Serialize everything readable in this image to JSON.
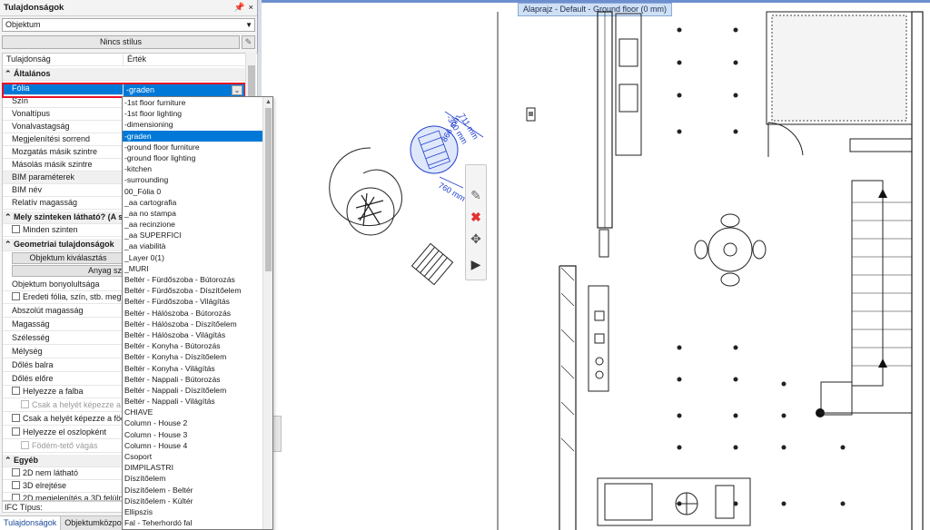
{
  "panel": {
    "title": "Tulajdonságok",
    "pin_glyph": "ᵖ",
    "close_glyph": "×",
    "object_select": "Objektum",
    "style_button": "Nincs stílus",
    "col_property": "Tulajdonság",
    "col_value": "Érték",
    "categories": {
      "general": "Általános",
      "visible_levels": "Mely szinteken látható? (A sa",
      "geometry": "Geometriai tulajdonságok",
      "other": "Egyéb"
    },
    "general_rows": [
      {
        "label": "Fólia"
      },
      {
        "label": "Szín"
      },
      {
        "label": "Vonaltípus"
      },
      {
        "label": "Vonalvastagság"
      },
      {
        "label": "Megjelenítési sorrend"
      },
      {
        "label": "Mozgatás másik szintre"
      },
      {
        "label": "Másolás másik szintre"
      },
      {
        "label": "BIM paraméterek"
      },
      {
        "label": "BIM név"
      },
      {
        "label": "Relatív magasság"
      }
    ],
    "folia_value": "-graden",
    "all_levels": "Minden szinten",
    "select_object_btn": "Objektum kiválasztás",
    "material_btn": "Anyag sz",
    "geometry_rows": [
      "Objektum bonyolultsága",
      "Eredeti fólia, szín, stb. megtartá",
      "Abszolút magasság",
      "Magasság",
      "Szélesség",
      "Mélység",
      "Dőlés balra",
      "Dőlés előre",
      "Helyezze a falba",
      "Csak a helyét képezze a falba",
      "Csak a helyét képezze a födémb",
      "Helyezze el oszlopként",
      "Födém-tető vágás"
    ],
    "other_rows": [
      "2D nem látható",
      "3D elrejtése",
      "2D megjelenítés a 3D felülnézete"
    ],
    "ifc_type": "IFC Típus:",
    "tabs": [
      "Tulajdonságok",
      "Objektumközpo"
    ]
  },
  "dropdown": {
    "selected_index": 3,
    "items": [
      "-1st floor furniture",
      "-1st floor lighting",
      "-dimensioning",
      "-graden",
      "-ground floor furniture",
      "-ground floor lighting",
      "-kitchen",
      "-surrounding",
      "00_Fólia 0",
      "_aa cartografia",
      "_aa no stampa",
      "_aa recinzione",
      "_aa SUPERFICI",
      "_aa viabilità",
      "_Layer 0(1)",
      "_MURI",
      "Beltér - Fürdőszoba - Bútorozás",
      "Beltér - Fürdőszoba - Díszítőelem",
      "Beltér - Fürdőszoba - Világítás",
      "Beltér - Hálószoba - Bútorozás",
      "Beltér - Hálószoba - Díszítőelem",
      "Beltér - Hálószoba - Világítás",
      "Beltér - Konyha - Bútorozás",
      "Beltér - Konyha - Díszítőelem",
      "Beltér - Konyha - Világítás",
      "Beltér - Nappali - Bútorozás",
      "Beltér - Nappali - Díszítőelem",
      "Beltér - Nappali - Világítás",
      "CHIAVE",
      "Column - House 2",
      "Column - House 3",
      "Column - House 4",
      "Csoport",
      "DIMPILASTRI",
      "Díszítőelem",
      "Díszítőelem - Beltér",
      "Díszítőelem - Kültér",
      "Ellipszis",
      "Fal - Teherhordó fal"
    ]
  },
  "viewport": {
    "title": "Alaprajz - Default - Ground floor (0 mm)",
    "dim_labels": [
      "711 mm",
      "-300 mm",
      "866 mm",
      "760 mm"
    ]
  },
  "floating_toolbar": {
    "icons": [
      "pencil-icon",
      "delete-x-icon",
      "move-arrows-icon",
      "play-arrow-icon"
    ]
  },
  "colors": {
    "selection": "#0078d7",
    "red_frame": "#e81123",
    "dimension_blue": "#1f3fd0",
    "delete_red": "#e23030"
  }
}
